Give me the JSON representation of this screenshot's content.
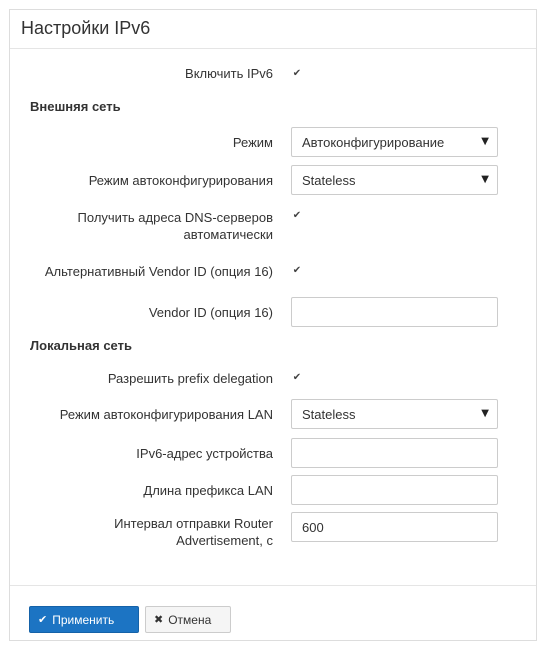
{
  "page": {
    "title": "Настройки IPv6"
  },
  "enable_ipv6": {
    "label": "Включить IPv6",
    "checked": true
  },
  "wan": {
    "section_title": "Внешняя сеть",
    "mode": {
      "label": "Режим",
      "value": "Автоконфигурирование"
    },
    "autoconf_mode": {
      "label": "Режим автоконфигурирования",
      "value": "Stateless"
    },
    "dns_auto": {
      "label_line1": "Получить адреса DNS-серверов",
      "label_line2": "автоматически",
      "checked": true
    },
    "alt_vendor_id": {
      "label": "Альтернативный Vendor ID (опция 16)",
      "checked": true
    },
    "vendor_id": {
      "label": "Vendor ID (опция 16)",
      "value": ""
    }
  },
  "lan": {
    "section_title": "Локальная сеть",
    "prefix_delegation": {
      "label": "Разрешить prefix delegation",
      "checked": true
    },
    "autoconf_mode_lan": {
      "label": "Режим автоконфигурирования LAN",
      "value": "Stateless"
    },
    "device_address": {
      "label": "IPv6-адрес устройства",
      "value": ""
    },
    "prefix_length": {
      "label": "Длина префикса LAN",
      "value": ""
    },
    "ra_interval": {
      "label_line1": "Интервал отправки Router",
      "label_line2": "Advertisement, с",
      "value": "600"
    }
  },
  "buttons": {
    "apply": "Применить",
    "cancel": "Отмена"
  },
  "icons": {
    "checkbox": "check-icon",
    "select_arrow": "caret-down-icon",
    "apply": "check-icon",
    "cancel": "close-icon"
  },
  "colors": {
    "primary": "#1c74c3",
    "border": "#cccccc"
  }
}
